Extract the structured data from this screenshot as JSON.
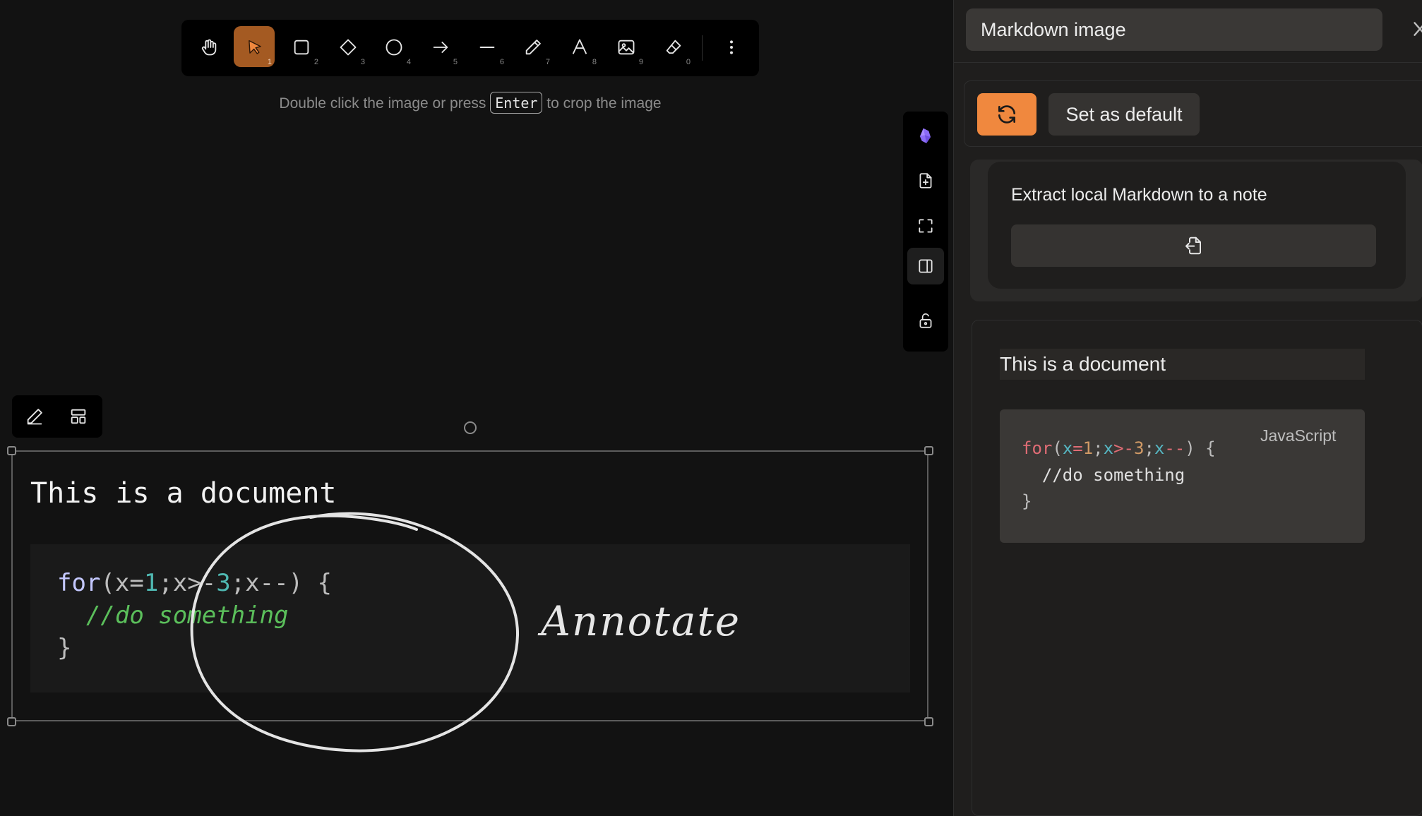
{
  "hint": {
    "before": "Double click the image or press",
    "key": "Enter",
    "after": "to crop the image"
  },
  "toolbar": {
    "tools": [
      {
        "name": "hand-icon",
        "key": ""
      },
      {
        "name": "selection-icon",
        "key": "1",
        "active": true
      },
      {
        "name": "rectangle-icon",
        "key": "2"
      },
      {
        "name": "diamond-icon",
        "key": "3"
      },
      {
        "name": "ellipse-icon",
        "key": "4"
      },
      {
        "name": "arrow-icon",
        "key": "5"
      },
      {
        "name": "line-icon",
        "key": "6"
      },
      {
        "name": "pencil-icon",
        "key": "7"
      },
      {
        "name": "text-icon",
        "key": "8"
      },
      {
        "name": "image-icon",
        "key": "9"
      },
      {
        "name": "eraser-icon",
        "key": "0"
      }
    ],
    "accent": "#a45a22"
  },
  "canvas": {
    "doc_title": "This is a document",
    "code": [
      [
        {
          "t": "for",
          "c": "#c4c8ff"
        },
        {
          "t": "(x=",
          "c": "#bdbdbd"
        },
        {
          "t": "1",
          "c": "#4fb8b2"
        },
        {
          "t": ";x>-",
          "c": "#bdbdbd"
        },
        {
          "t": "3",
          "c": "#4fb8b2"
        },
        {
          "t": ";x--) {",
          "c": "#bdbdbd"
        }
      ],
      [
        {
          "t": "  //do something",
          "c": "#5bbf5b",
          "i": true
        }
      ],
      [
        {
          "t": "}",
          "c": "#bdbdbd"
        }
      ]
    ],
    "annotation": "Annotate"
  },
  "panel": {
    "title": "Markdown image",
    "set_default": "Set as default",
    "extract_label": "Extract local Markdown to a note",
    "preview_title": "This is a document",
    "code_language": "JavaScript",
    "accent": "#f0883e",
    "code": [
      [
        {
          "t": "for",
          "c": "#e06c75"
        },
        {
          "t": "(",
          "c": "#bdbdbd"
        },
        {
          "t": "x",
          "c": "#56b6c2"
        },
        {
          "t": "=",
          "c": "#e06c75"
        },
        {
          "t": "1",
          "c": "#d19a66"
        },
        {
          "t": ";",
          "c": "#bdbdbd"
        },
        {
          "t": "x",
          "c": "#56b6c2"
        },
        {
          "t": ">",
          "c": "#e06c75"
        },
        {
          "t": "-",
          "c": "#e06c75"
        },
        {
          "t": "3",
          "c": "#d19a66"
        },
        {
          "t": ";",
          "c": "#bdbdbd"
        },
        {
          "t": "x",
          "c": "#56b6c2"
        },
        {
          "t": "--",
          "c": "#e06c75"
        },
        {
          "t": ") {",
          "c": "#bdbdbd"
        }
      ],
      [
        {
          "t": "  //do something",
          "c": "#e0e0e0"
        }
      ],
      [
        {
          "t": "}",
          "c": "#bdbdbd"
        }
      ]
    ]
  }
}
